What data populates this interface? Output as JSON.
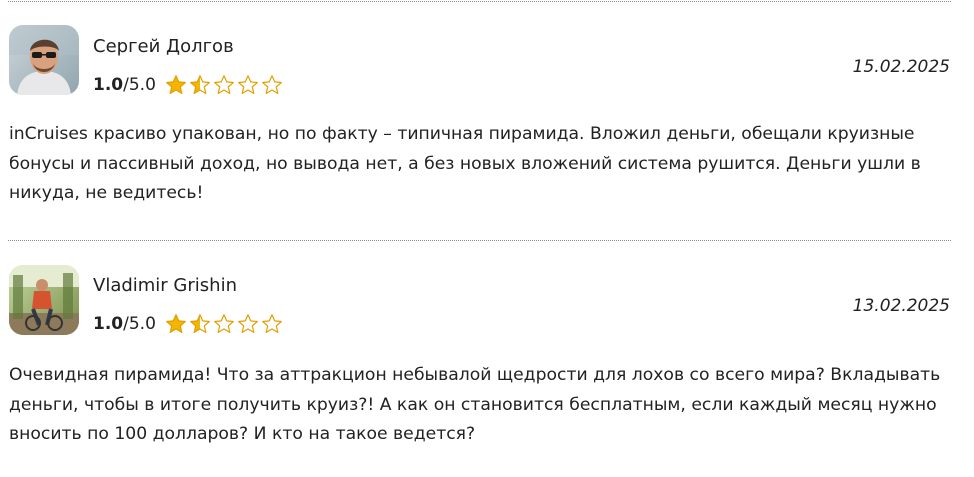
{
  "reviews": [
    {
      "author": "Сергей Долгов",
      "rating_value": "1.0",
      "rating_max": "/5.0",
      "stars_filled": 1.5,
      "stars_total": 5,
      "date": "15.02.2025",
      "text": "inCruises красиво упакован, но по факту – типичная пирамида. Вложил деньги, обещали круизные бонусы и пассивный доход, но вывода нет, а без новых вложений система рушится. Деньги ушли в никуда, не ведитесь!"
    },
    {
      "author": "Vladimir Grishin",
      "rating_value": "1.0",
      "rating_max": "/5.0",
      "stars_filled": 1.5,
      "stars_total": 5,
      "date": "13.02.2025",
      "text": "Очевидная пирамида! Что за аттракцион небывалой щедрости для лохов со всего мира? Вкладывать деньги, чтобы в итоге получить круиз?! А как он становится бесплатным, если каждый месяц нужно вносить по 100 долларов? И кто на такое ведется?"
    }
  ],
  "colors": {
    "star_fill": "#f4b400",
    "star_stroke": "#e0a000",
    "divider": "#8a8a8a",
    "text": "#222222"
  }
}
